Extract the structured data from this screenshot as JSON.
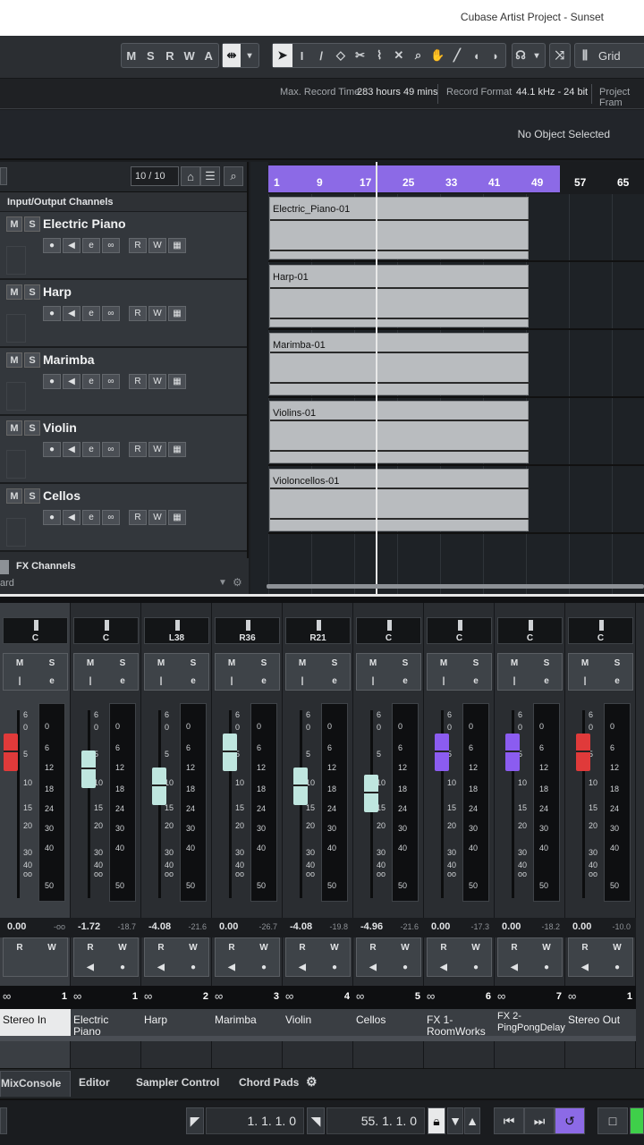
{
  "window": {
    "title": "Cubase Artist Project - Sunset"
  },
  "toolbar": {
    "state_buttons": [
      "M",
      "S",
      "R",
      "W",
      "A"
    ],
    "tools": [
      "object-select-icon",
      "range-select-icon",
      "draw-icon",
      "erase-icon",
      "split-icon",
      "glue-icon",
      "mute-icon",
      "zoom-icon",
      "hand-icon",
      "line-icon",
      "play-tool-icon",
      "speaker-icon"
    ],
    "snap_label": "Grid"
  },
  "info": {
    "max_record_label": "Max. Record Time",
    "max_record_value": "283 hours 49 mins",
    "format_label": "Record Format",
    "format_value": "44.1 kHz - 24 bit",
    "project_label": "Project Fram"
  },
  "selection": {
    "text": "No Object Selected"
  },
  "tracklist": {
    "count": "10 / 10",
    "folder": "Input/Output Channels",
    "tracks": [
      {
        "name": "Electric Piano"
      },
      {
        "name": "Harp"
      },
      {
        "name": "Marimba"
      },
      {
        "name": "Violin"
      },
      {
        "name": "Cellos"
      }
    ],
    "fx_folder": "FX Channels",
    "partial_label": "ard",
    "ctrl_icons": [
      "●",
      "◀",
      "e",
      "∞",
      "R",
      "W",
      "▦"
    ]
  },
  "ruler": {
    "marks": [
      "1",
      "9",
      "17",
      "25",
      "33",
      "41",
      "49",
      "57",
      "65"
    ]
  },
  "clips": [
    "Electric_Piano-01",
    "Harp-01",
    "Marimba-01",
    "Violins-01",
    "Violoncellos-01"
  ],
  "mixer": {
    "channels": [
      {
        "pan": "C",
        "vol": "0.00",
        "peak": "-oo",
        "num": "1",
        "name": "Stereo In",
        "color": "#e03a3a",
        "level": 0.83
      },
      {
        "pan": "C",
        "vol": "-1.72",
        "peak": "-18.7",
        "num": "1",
        "name": "Electric Piano",
        "color": "#bfe6df",
        "level": 0.74
      },
      {
        "pan": "L38",
        "vol": "-4.08",
        "peak": "-21.6",
        "num": "2",
        "name": "Harp",
        "color": "#bfe6df",
        "level": 0.65
      },
      {
        "pan": "R36",
        "vol": "0.00",
        "peak": "-26.7",
        "num": "3",
        "name": "Marimba",
        "color": "#bfe6df",
        "level": 0.83
      },
      {
        "pan": "R21",
        "vol": "-4.08",
        "peak": "-19.8",
        "num": "4",
        "name": "Violin",
        "color": "#bfe6df",
        "level": 0.65
      },
      {
        "pan": "C",
        "vol": "-4.96",
        "peak": "-21.6",
        "num": "5",
        "name": "Cellos",
        "color": "#bfe6df",
        "level": 0.61
      },
      {
        "pan": "C",
        "vol": "0.00",
        "peak": "-17.3",
        "num": "6",
        "name": "FX 1-RoomWorks",
        "color": "#8b5cf0",
        "level": 0.83
      },
      {
        "pan": "C",
        "vol": "0.00",
        "peak": "-18.2",
        "num": "7",
        "name": "FX 2-PingPongDelay",
        "color": "#8b5cf0",
        "level": 0.83
      },
      {
        "pan": "C",
        "vol": "0.00",
        "peak": "-10.0",
        "num": "1",
        "name": "Stereo Out",
        "color": "#e03a3a",
        "level": 0.83
      }
    ],
    "scale": [
      "6",
      "0",
      "5",
      "10",
      "15",
      "20",
      "30",
      "40",
      "oo"
    ],
    "meter_scale": [
      "0",
      "6",
      "12",
      "18",
      "24",
      "30",
      "40",
      "50"
    ],
    "ms": {
      "m": "M",
      "s": "S",
      "r": "R",
      "w": "W",
      "e": "e"
    }
  },
  "tabs": [
    "MixConsole",
    "Editor",
    "Sampler Control",
    "Chord Pads"
  ],
  "transport": {
    "left_locator": "1. 1. 1.   0",
    "right_locator": "55. 1. 1.   0"
  }
}
